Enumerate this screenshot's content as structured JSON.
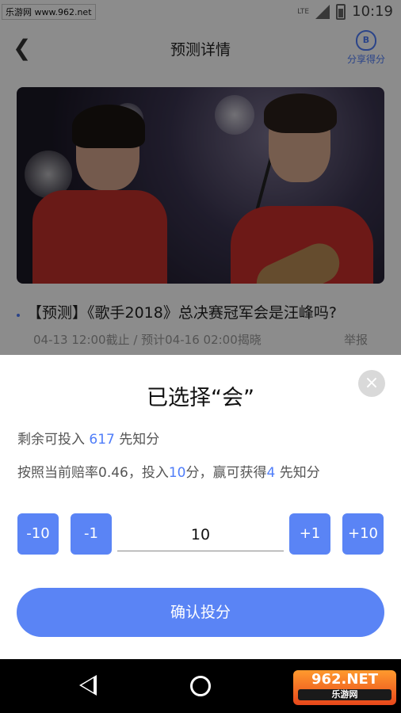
{
  "status_bar": {
    "watermark": "乐游网 www.962.net",
    "network": "LTE",
    "time": "10:19"
  },
  "header": {
    "title": "预测详情",
    "back_icon": "chevron-left-icon",
    "share_label": "分享得分",
    "share_badge": "B"
  },
  "question": {
    "title": "【预测】《歌手2018》总决赛冠军会是汪峰吗?",
    "meta": "04-13 12:00截止 / 预计04-16 02:00揭晓",
    "report": "举报"
  },
  "sheet": {
    "title": "已选择“会”",
    "close": "×",
    "balance_prefix": "剩余可投入 ",
    "balance_value": "617",
    "balance_suffix": " 先知分",
    "odds_prefix": "按照当前赔率0.46，投入",
    "odds_bet": "10",
    "odds_mid": "分，赢可获得",
    "odds_win": "4",
    "odds_suffix": " 先知分",
    "buttons": {
      "minus10": "-10",
      "minus1": "-1",
      "plus1": "+1",
      "plus10": "+10"
    },
    "quantity": "10",
    "confirm": "确认投分"
  },
  "logo": {
    "main": "962.NET",
    "sub": "乐游网"
  },
  "colors": {
    "accent": "#5a84f5",
    "highlight": "#4f7df9"
  }
}
